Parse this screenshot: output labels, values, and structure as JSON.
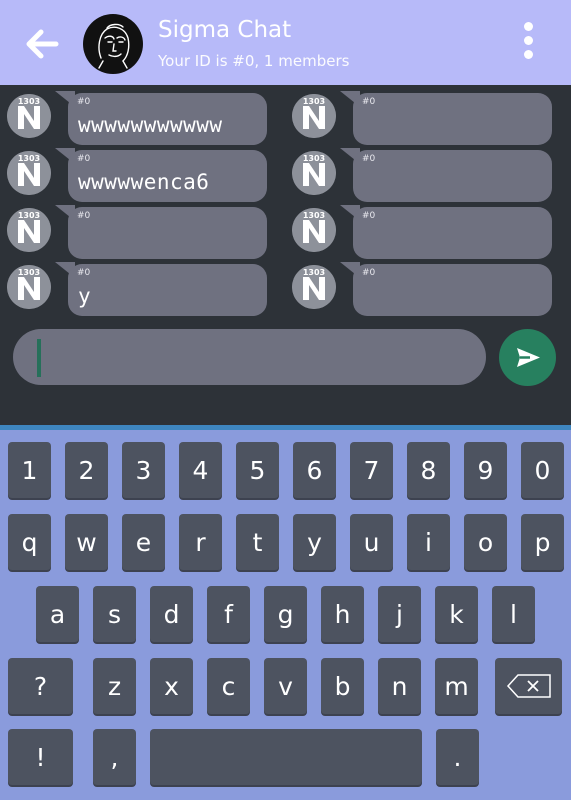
{
  "header": {
    "title": "Sigma Chat",
    "subtitle": "Your ID is #0, 1 members"
  },
  "messages": [
    {
      "sender": "#0",
      "text": "wwwwwwwwwww",
      "badge": "1303",
      "badge_letter": "N"
    },
    {
      "sender": "#0",
      "text": "",
      "badge": "1303",
      "badge_letter": "N"
    },
    {
      "sender": "#0",
      "text": "wwwwwenca6",
      "badge": "1303",
      "badge_letter": "N"
    },
    {
      "sender": "#0",
      "text": "",
      "badge": "1303",
      "badge_letter": "N"
    },
    {
      "sender": "#0",
      "text": "",
      "badge": "1303",
      "badge_letter": "N"
    },
    {
      "sender": "#0",
      "text": "",
      "badge": "1303",
      "badge_letter": "N"
    },
    {
      "sender": "#0",
      "text": "y",
      "badge": "1303",
      "badge_letter": "N"
    },
    {
      "sender": "#0",
      "text": "",
      "badge": "1303",
      "badge_letter": "N"
    }
  ],
  "input": {
    "value": ""
  },
  "keyboard": {
    "row1": [
      "1",
      "2",
      "3",
      "4",
      "5",
      "6",
      "7",
      "8",
      "9",
      "0"
    ],
    "row2": [
      "q",
      "w",
      "e",
      "r",
      "t",
      "y",
      "u",
      "i",
      "o",
      "p"
    ],
    "row3": [
      "a",
      "s",
      "d",
      "f",
      "g",
      "h",
      "j",
      "k",
      "l"
    ],
    "row4": [
      "?",
      "z",
      "x",
      "c",
      "v",
      "b",
      "n",
      "m"
    ],
    "row5": [
      "!",
      ",",
      "."
    ]
  },
  "colors": {
    "header_bg": "#b7baf9",
    "chat_bg": "#2d3238",
    "bubble": "#6f7180",
    "send_button": "#27805f",
    "keyboard_bg": "#8a9bdc",
    "key_bg": "#4d5360"
  },
  "icons": {
    "back": "arrow-left-icon",
    "menu": "more-vertical-icon",
    "send": "send-icon",
    "backspace": "backspace-icon"
  }
}
